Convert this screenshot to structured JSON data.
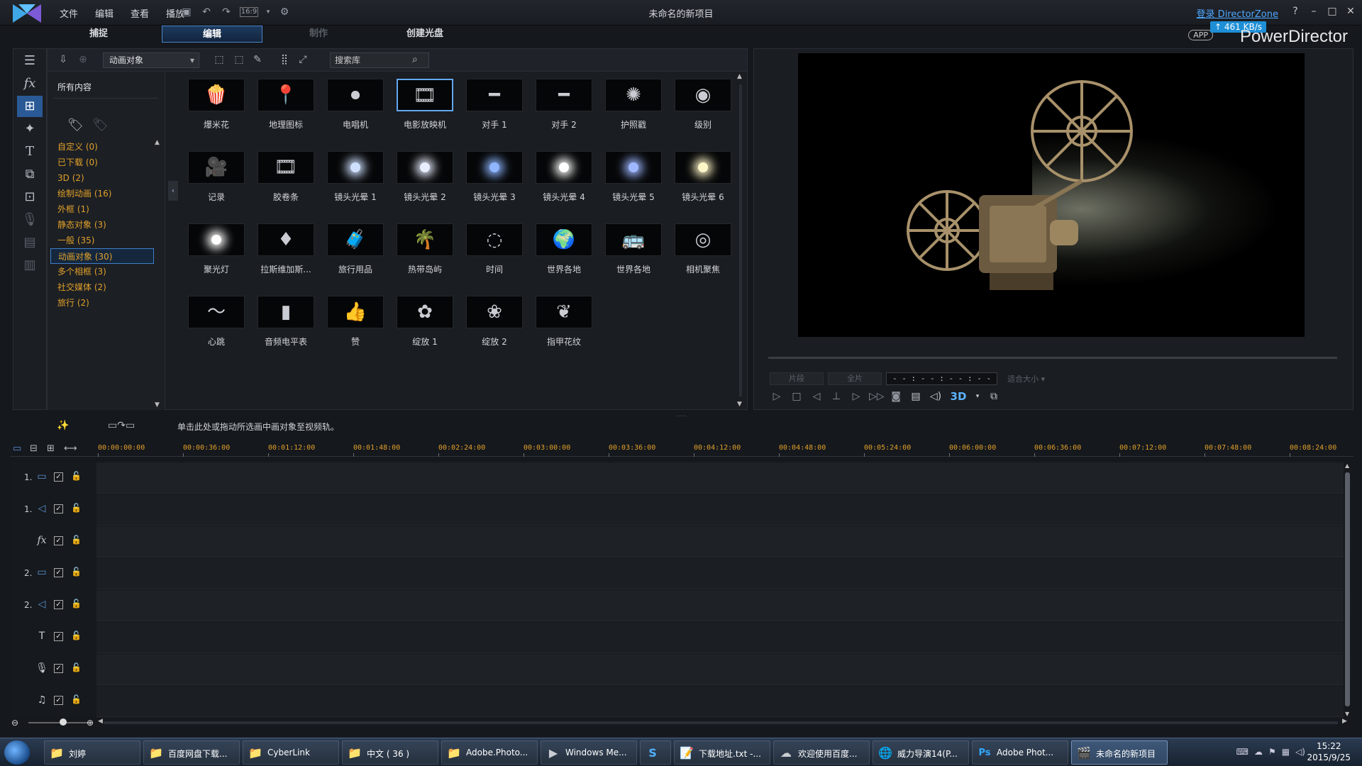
{
  "titlebar": {
    "menu": [
      "文件",
      "编辑",
      "查看",
      "播放"
    ],
    "aspect": "16:9",
    "title": "未命名的新项目",
    "login": "登录 DirectorZone"
  },
  "modes": [
    {
      "label": "捕捉",
      "state": "normal"
    },
    {
      "label": "编辑",
      "state": "active"
    },
    {
      "label": "制作",
      "state": "dim"
    },
    {
      "label": "创建光盘",
      "state": "normal"
    }
  ],
  "brand": {
    "app_badge": "APP",
    "speed": "461 KB/s",
    "name": "PowerDirector"
  },
  "library": {
    "category_select": "动画对象",
    "search_placeholder": "搜索库",
    "all_content": "所有内容",
    "categories": [
      {
        "label": "自定义  (0)"
      },
      {
        "label": "已下载  (0)"
      },
      {
        "label": "3D  (2)"
      },
      {
        "label": "绘制动画  (16)"
      },
      {
        "label": "外框  (1)"
      },
      {
        "label": "静态对象  (3)"
      },
      {
        "label": "一般  (35)"
      },
      {
        "label": "动画对象  (30)"
      },
      {
        "label": "多个相框  (3)"
      },
      {
        "label": "社交媒体  (2)"
      },
      {
        "label": "旅行  (2)"
      }
    ],
    "active_category_index": 7,
    "items": [
      {
        "label": "爆米花",
        "glyph": "🍿"
      },
      {
        "label": "地理图标",
        "glyph": "📍"
      },
      {
        "label": "电唱机",
        "glyph": "⏺"
      },
      {
        "label": "电影放映机",
        "glyph": "🎞"
      },
      {
        "label": "对手 1",
        "glyph": "━"
      },
      {
        "label": "对手 2",
        "glyph": "━"
      },
      {
        "label": "护照戳",
        "glyph": "✺"
      },
      {
        "label": "级别",
        "glyph": "◉"
      },
      {
        "label": "记录",
        "glyph": "🎥"
      },
      {
        "label": "胶卷条",
        "glyph": "🎞"
      },
      {
        "label": "镜头光晕 1",
        "glyph": ""
      },
      {
        "label": "镜头光晕 2",
        "glyph": ""
      },
      {
        "label": "镜头光晕 3",
        "glyph": ""
      },
      {
        "label": "镜头光晕 4",
        "glyph": ""
      },
      {
        "label": "镜头光晕 5",
        "glyph": ""
      },
      {
        "label": "镜头光晕 6",
        "glyph": ""
      },
      {
        "label": "聚光灯",
        "glyph": ""
      },
      {
        "label": "拉斯维加斯...",
        "glyph": "♦"
      },
      {
        "label": "旅行用品",
        "glyph": "🧳"
      },
      {
        "label": "热带岛屿",
        "glyph": "🌴"
      },
      {
        "label": "时间",
        "glyph": "◌"
      },
      {
        "label": "世界各地",
        "glyph": "🌍"
      },
      {
        "label": "世界各地",
        "glyph": "🚌"
      },
      {
        "label": "相机聚焦",
        "glyph": "◎"
      },
      {
        "label": "心跳",
        "glyph": "〜"
      },
      {
        "label": "音频电平表",
        "glyph": "▮"
      },
      {
        "label": "赞",
        "glyph": "👍"
      },
      {
        "label": "绽放 1",
        "glyph": "✿"
      },
      {
        "label": "绽放 2",
        "glyph": "❀"
      },
      {
        "label": "指甲花纹",
        "glyph": "❦"
      }
    ],
    "selected_item_index": 3
  },
  "preview": {
    "btn_clip": "片段",
    "btn_movie": "全片",
    "timecode": "- - : - - : - - : - -",
    "fit": "适合大小",
    "btn_3d": "3D"
  },
  "timeline": {
    "hint": "单击此处或拖动所选画中画对象至视频轨。",
    "ticks": [
      "00:00:00:00",
      "00:00:36:00",
      "00:01:12:00",
      "00:01:48:00",
      "00:02:24:00",
      "00:03:00:00",
      "00:03:36:00",
      "00:04:12:00",
      "00:04:48:00",
      "00:05:24:00",
      "00:06:00:00",
      "00:06:36:00",
      "00:07:12:00",
      "00:07:48:00",
      "00:08:24:00"
    ],
    "tracks": [
      {
        "num": "1.",
        "icon": "video-icon",
        "glyph": "▭"
      },
      {
        "num": "1.",
        "icon": "audio-icon",
        "glyph": "◁"
      },
      {
        "num": "",
        "icon": "fx-icon",
        "glyph": "fx"
      },
      {
        "num": "2.",
        "icon": "video-icon",
        "glyph": "▭"
      },
      {
        "num": "2.",
        "icon": "audio-icon",
        "glyph": "◁"
      },
      {
        "num": "",
        "icon": "title-icon",
        "glyph": "T"
      },
      {
        "num": "",
        "icon": "voice-icon",
        "glyph": "🎙"
      },
      {
        "num": "",
        "icon": "music-icon",
        "glyph": "♫"
      }
    ]
  },
  "taskbar": {
    "tasks": [
      {
        "label": "刘婷",
        "glyph": "📁"
      },
      {
        "label": "百度网盘下载...",
        "glyph": "📁"
      },
      {
        "label": "CyberLink",
        "glyph": "📁"
      },
      {
        "label": "中文 ( 36 )",
        "glyph": "📁"
      },
      {
        "label": "Adobe.Photo...",
        "glyph": "📁"
      },
      {
        "label": "Windows Me...",
        "glyph": "▶"
      },
      {
        "label": "",
        "glyph": "S"
      },
      {
        "label": "下载地址.txt -...",
        "glyph": "📝"
      },
      {
        "label": "欢迎使用百度...",
        "glyph": "☁"
      },
      {
        "label": "威力导演14(P...",
        "glyph": "🌐"
      },
      {
        "label": "Adobe Phot...",
        "glyph": "Ps"
      },
      {
        "label": "未命名的新项目",
        "glyph": "🎬"
      }
    ],
    "active_task_index": 11,
    "time": "15:22",
    "date": "2015/9/25"
  }
}
